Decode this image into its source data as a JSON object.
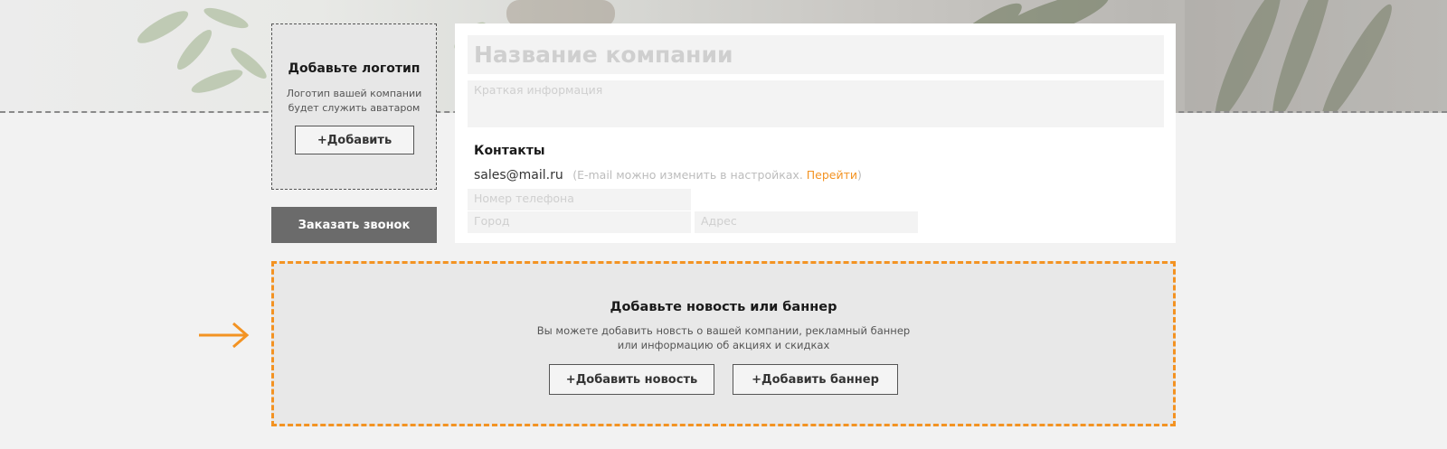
{
  "cover": {
    "icon": "plant-photo"
  },
  "logo": {
    "title": "Добавьте логотип",
    "description": "Логотип вашей компании будет служить аватаром",
    "add_label": "+Добавить"
  },
  "call_button": "Заказать звонок",
  "company": {
    "name_placeholder": "Название компании",
    "info_placeholder": "Краткая информация"
  },
  "contacts": {
    "title": "Контакты",
    "email": "sales@mail.ru",
    "note_open": "(E-mail можно изменить в настройках. ",
    "note_link": "Перейти",
    "note_close": ")",
    "phone_placeholder": "Номер телефона",
    "city_placeholder": "Город",
    "address_placeholder": "Адрес"
  },
  "news": {
    "title": "Добавьте новость или баннер",
    "description_line1": "Вы можете добавить новсть о вашей компании, рекламный баннер",
    "description_line2": "или информацию об акциях и скидках",
    "add_news_label": "+Добавить новость",
    "add_banner_label": "+Добавить баннер"
  },
  "colors": {
    "accent": "#f39323",
    "dark_button": "#6b6b6b",
    "background": "#f2f2f2"
  }
}
